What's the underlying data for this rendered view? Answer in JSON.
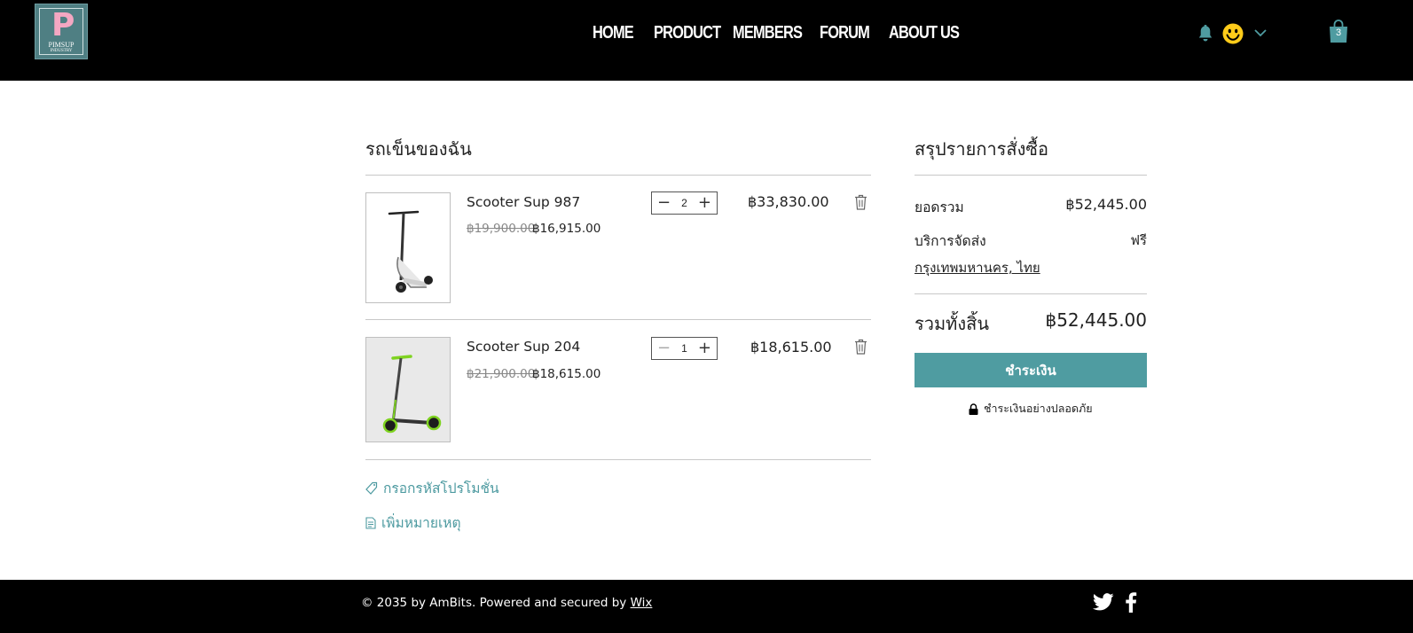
{
  "header": {
    "logo": {
      "letter": "P",
      "line1": "PIMSUP",
      "line2": "INDUSTRY"
    },
    "nav": [
      "HOME",
      "PRODUCT",
      "MEMBERS",
      "FORUM",
      "ABOUT US"
    ],
    "icons": {
      "notifications": "bell-icon",
      "account": "smiley-avatar-icon",
      "account_menu": "chevron-down-icon",
      "cart": "shopping-bag-icon"
    },
    "cart_count": "3",
    "accent_color": "#4f9ca1"
  },
  "cart": {
    "title": "รถเข็นของฉัน",
    "items": [
      {
        "name": "Scooter Sup 987",
        "old_price": "฿19,900.00",
        "price": "฿16,915.00",
        "qty": "2",
        "total": "฿33,830.00"
      },
      {
        "name": "Scooter Sup 204",
        "old_price": "฿21,900.00",
        "price": "฿18,615.00",
        "qty": "1",
        "total": "฿18,615.00"
      }
    ],
    "promo_label": "กรอกรหัสโปรโมชั่น",
    "note_label": "เพิ่มหมายเหตุ"
  },
  "summary": {
    "title": "สรุปรายการสั่งซื้อ",
    "subtotal_label": "ยอดรวม",
    "subtotal_value": "฿52,445.00",
    "shipping_label": "บริการจัดส่ง",
    "shipping_value": "ฟรี",
    "location": "กรุงเทพมหานคร, ไทย",
    "total_label": "รวมทั้งสิ้น",
    "total_value": "฿52,445.00",
    "checkout_label": "ชำระเงิน",
    "secure_label": "ชำระเงินอย่างปลอดภัย"
  },
  "footer": {
    "copyright": "© 2035 by AmBits. Powered and secured by",
    "wix": "Wix"
  }
}
